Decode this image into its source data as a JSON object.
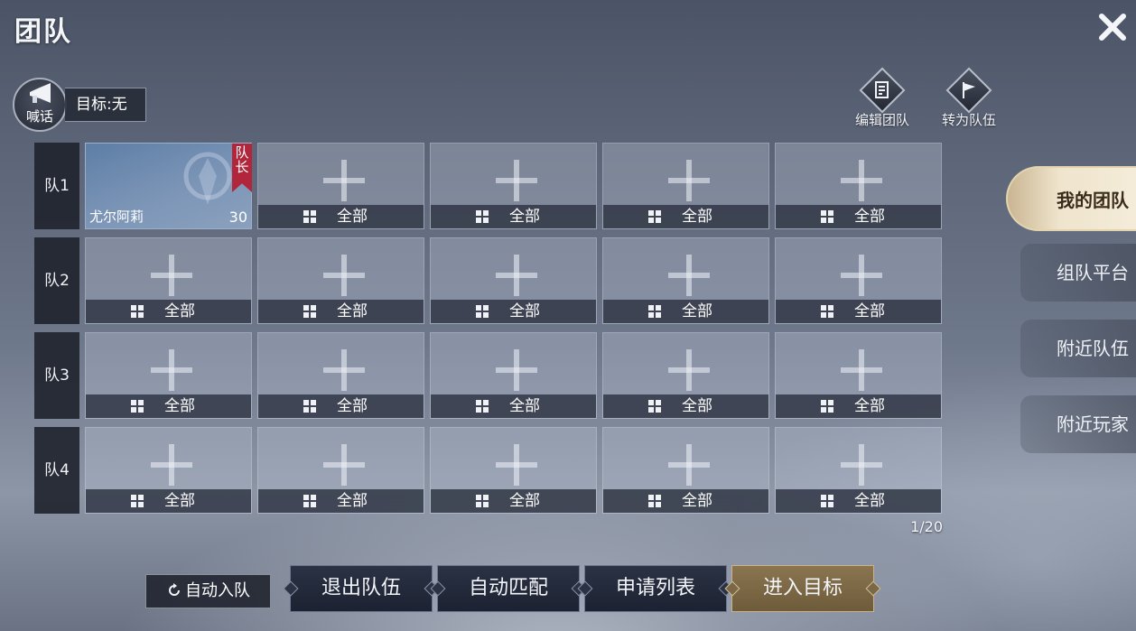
{
  "header": {
    "title": "团队"
  },
  "shout": {
    "label": "喊话",
    "target": "目标:无"
  },
  "tools": [
    {
      "label": "编辑团队",
      "icon": "edit-roster-icon"
    },
    {
      "label": "转为队伍",
      "icon": "flag-icon"
    }
  ],
  "rows": [
    {
      "label": "队1",
      "slots": [
        {
          "type": "member",
          "name": "尤尔阿莉",
          "level": "30",
          "badge": "队长"
        },
        {
          "type": "empty",
          "filter": "全部"
        },
        {
          "type": "empty",
          "filter": "全部"
        },
        {
          "type": "empty",
          "filter": "全部"
        },
        {
          "type": "empty",
          "filter": "全部"
        }
      ]
    },
    {
      "label": "队2",
      "slots": [
        {
          "type": "empty",
          "filter": "全部"
        },
        {
          "type": "empty",
          "filter": "全部"
        },
        {
          "type": "empty",
          "filter": "全部"
        },
        {
          "type": "empty",
          "filter": "全部"
        },
        {
          "type": "empty",
          "filter": "全部"
        }
      ]
    },
    {
      "label": "队3",
      "slots": [
        {
          "type": "empty",
          "filter": "全部"
        },
        {
          "type": "empty",
          "filter": "全部"
        },
        {
          "type": "empty",
          "filter": "全部"
        },
        {
          "type": "empty",
          "filter": "全部"
        },
        {
          "type": "empty",
          "filter": "全部"
        }
      ]
    },
    {
      "label": "队4",
      "slots": [
        {
          "type": "empty",
          "filter": "全部"
        },
        {
          "type": "empty",
          "filter": "全部"
        },
        {
          "type": "empty",
          "filter": "全部"
        },
        {
          "type": "empty",
          "filter": "全部"
        },
        {
          "type": "empty",
          "filter": "全部"
        }
      ]
    }
  ],
  "page_indicator": "1/20",
  "side_tabs": [
    {
      "label": "我的团队",
      "active": true
    },
    {
      "label": "组队平台",
      "active": false
    },
    {
      "label": "附近队伍",
      "active": false
    },
    {
      "label": "附近玩家",
      "active": false
    }
  ],
  "bottom": {
    "auto_join": "自动入队",
    "buttons": [
      {
        "label": "退出队伍",
        "style": "dark"
      },
      {
        "label": "自动匹配",
        "style": "dark"
      },
      {
        "label": "申请列表",
        "style": "dark"
      },
      {
        "label": "进入目标",
        "style": "gold"
      }
    ]
  }
}
